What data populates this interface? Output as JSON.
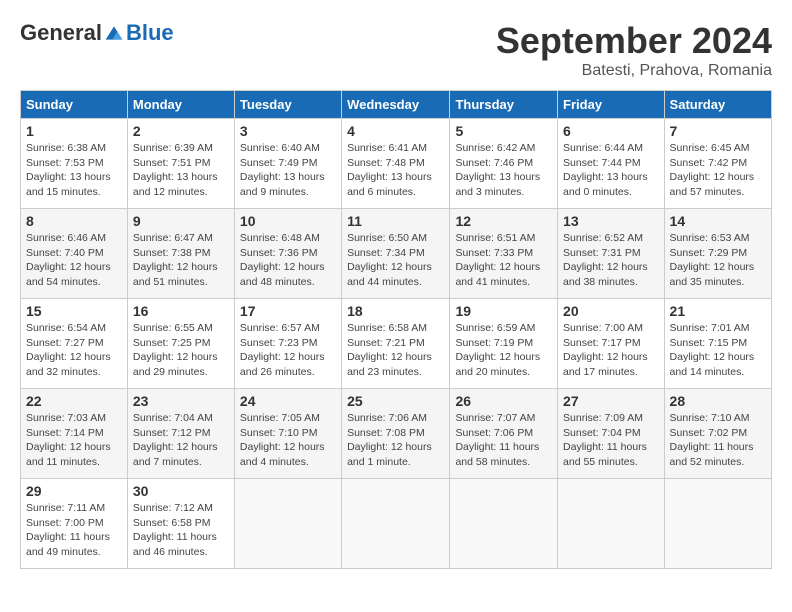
{
  "header": {
    "logo": {
      "part1": "General",
      "part2": "Blue"
    },
    "title": "September 2024",
    "location": "Batesti, Prahova, Romania"
  },
  "calendar": {
    "columns": [
      "Sunday",
      "Monday",
      "Tuesday",
      "Wednesday",
      "Thursday",
      "Friday",
      "Saturday"
    ],
    "weeks": [
      [
        null,
        null,
        null,
        null,
        null,
        null,
        null
      ]
    ],
    "days": [
      {
        "date": 1,
        "dow": 0,
        "sunrise": "6:38 AM",
        "sunset": "7:53 PM",
        "daylight": "13 hours and 15 minutes."
      },
      {
        "date": 2,
        "dow": 1,
        "sunrise": "6:39 AM",
        "sunset": "7:51 PM",
        "daylight": "13 hours and 12 minutes."
      },
      {
        "date": 3,
        "dow": 2,
        "sunrise": "6:40 AM",
        "sunset": "7:49 PM",
        "daylight": "13 hours and 9 minutes."
      },
      {
        "date": 4,
        "dow": 3,
        "sunrise": "6:41 AM",
        "sunset": "7:48 PM",
        "daylight": "13 hours and 6 minutes."
      },
      {
        "date": 5,
        "dow": 4,
        "sunrise": "6:42 AM",
        "sunset": "7:46 PM",
        "daylight": "13 hours and 3 minutes."
      },
      {
        "date": 6,
        "dow": 5,
        "sunrise": "6:44 AM",
        "sunset": "7:44 PM",
        "daylight": "13 hours and 0 minutes."
      },
      {
        "date": 7,
        "dow": 6,
        "sunrise": "6:45 AM",
        "sunset": "7:42 PM",
        "daylight": "12 hours and 57 minutes."
      },
      {
        "date": 8,
        "dow": 0,
        "sunrise": "6:46 AM",
        "sunset": "7:40 PM",
        "daylight": "12 hours and 54 minutes."
      },
      {
        "date": 9,
        "dow": 1,
        "sunrise": "6:47 AM",
        "sunset": "7:38 PM",
        "daylight": "12 hours and 51 minutes."
      },
      {
        "date": 10,
        "dow": 2,
        "sunrise": "6:48 AM",
        "sunset": "7:36 PM",
        "daylight": "12 hours and 48 minutes."
      },
      {
        "date": 11,
        "dow": 3,
        "sunrise": "6:50 AM",
        "sunset": "7:34 PM",
        "daylight": "12 hours and 44 minutes."
      },
      {
        "date": 12,
        "dow": 4,
        "sunrise": "6:51 AM",
        "sunset": "7:33 PM",
        "daylight": "12 hours and 41 minutes."
      },
      {
        "date": 13,
        "dow": 5,
        "sunrise": "6:52 AM",
        "sunset": "7:31 PM",
        "daylight": "12 hours and 38 minutes."
      },
      {
        "date": 14,
        "dow": 6,
        "sunrise": "6:53 AM",
        "sunset": "7:29 PM",
        "daylight": "12 hours and 35 minutes."
      },
      {
        "date": 15,
        "dow": 0,
        "sunrise": "6:54 AM",
        "sunset": "7:27 PM",
        "daylight": "12 hours and 32 minutes."
      },
      {
        "date": 16,
        "dow": 1,
        "sunrise": "6:55 AM",
        "sunset": "7:25 PM",
        "daylight": "12 hours and 29 minutes."
      },
      {
        "date": 17,
        "dow": 2,
        "sunrise": "6:57 AM",
        "sunset": "7:23 PM",
        "daylight": "12 hours and 26 minutes."
      },
      {
        "date": 18,
        "dow": 3,
        "sunrise": "6:58 AM",
        "sunset": "7:21 PM",
        "daylight": "12 hours and 23 minutes."
      },
      {
        "date": 19,
        "dow": 4,
        "sunrise": "6:59 AM",
        "sunset": "7:19 PM",
        "daylight": "12 hours and 20 minutes."
      },
      {
        "date": 20,
        "dow": 5,
        "sunrise": "7:00 AM",
        "sunset": "7:17 PM",
        "daylight": "12 hours and 17 minutes."
      },
      {
        "date": 21,
        "dow": 6,
        "sunrise": "7:01 AM",
        "sunset": "7:15 PM",
        "daylight": "12 hours and 14 minutes."
      },
      {
        "date": 22,
        "dow": 0,
        "sunrise": "7:03 AM",
        "sunset": "7:14 PM",
        "daylight": "12 hours and 11 minutes."
      },
      {
        "date": 23,
        "dow": 1,
        "sunrise": "7:04 AM",
        "sunset": "7:12 PM",
        "daylight": "12 hours and 7 minutes."
      },
      {
        "date": 24,
        "dow": 2,
        "sunrise": "7:05 AM",
        "sunset": "7:10 PM",
        "daylight": "12 hours and 4 minutes."
      },
      {
        "date": 25,
        "dow": 3,
        "sunrise": "7:06 AM",
        "sunset": "7:08 PM",
        "daylight": "12 hours and 1 minute."
      },
      {
        "date": 26,
        "dow": 4,
        "sunrise": "7:07 AM",
        "sunset": "7:06 PM",
        "daylight": "11 hours and 58 minutes."
      },
      {
        "date": 27,
        "dow": 5,
        "sunrise": "7:09 AM",
        "sunset": "7:04 PM",
        "daylight": "11 hours and 55 minutes."
      },
      {
        "date": 28,
        "dow": 6,
        "sunrise": "7:10 AM",
        "sunset": "7:02 PM",
        "daylight": "11 hours and 52 minutes."
      },
      {
        "date": 29,
        "dow": 0,
        "sunrise": "7:11 AM",
        "sunset": "7:00 PM",
        "daylight": "11 hours and 49 minutes."
      },
      {
        "date": 30,
        "dow": 1,
        "sunrise": "7:12 AM",
        "sunset": "6:58 PM",
        "daylight": "11 hours and 46 minutes."
      }
    ]
  }
}
